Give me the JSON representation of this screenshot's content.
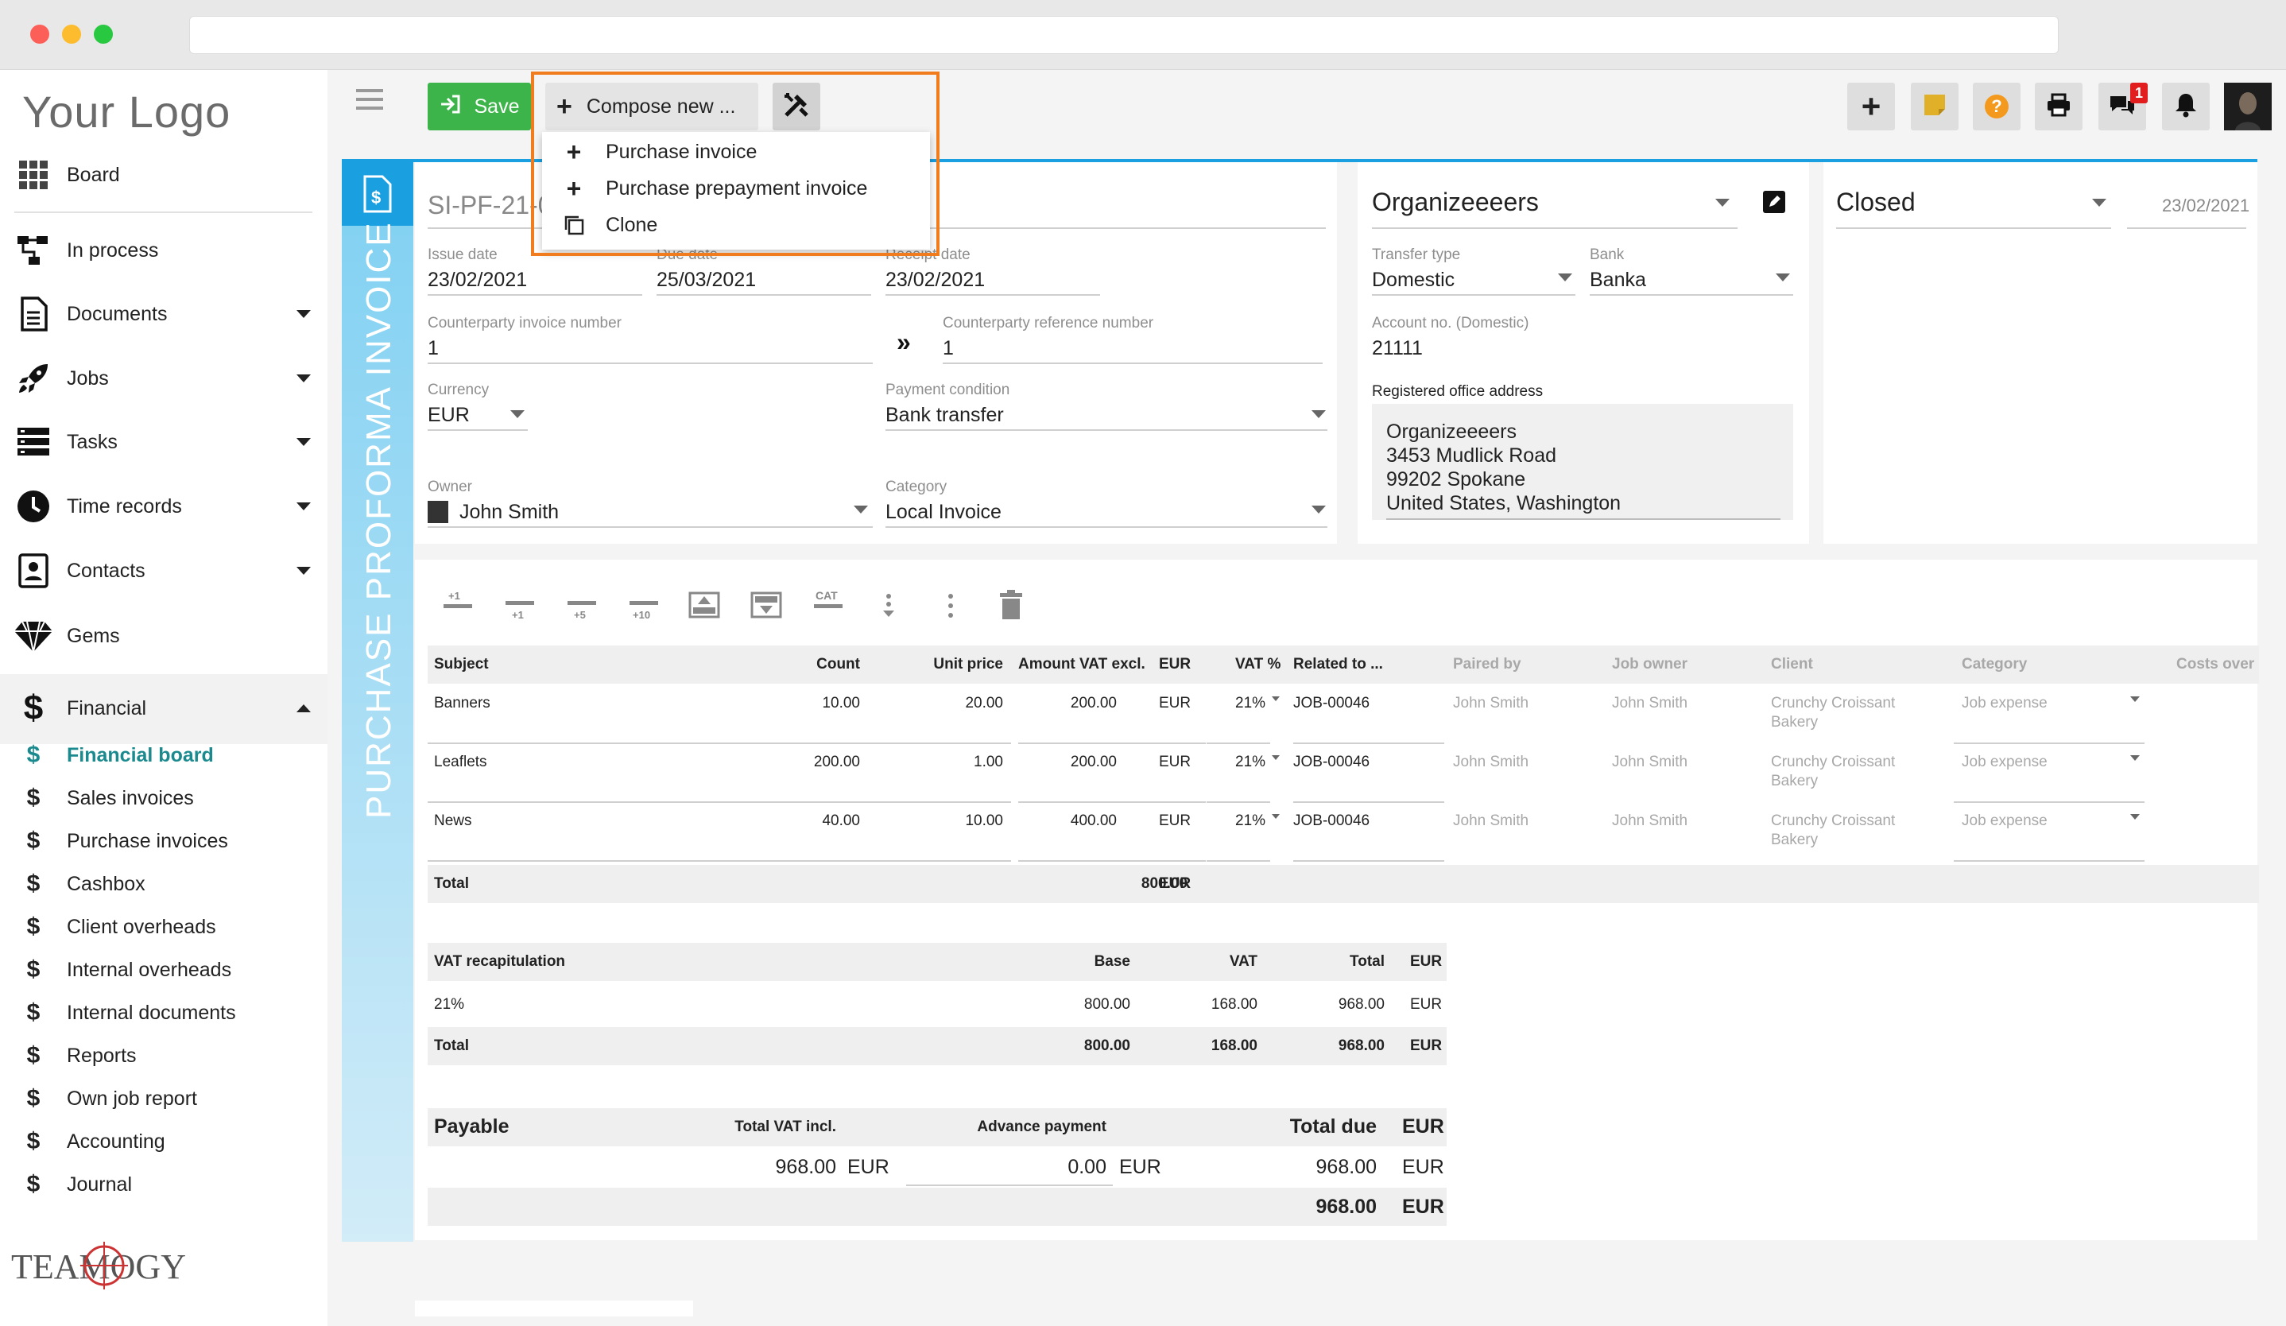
{
  "app": {
    "logo_text": "Your Logo",
    "footer_brand": "TEAMOGY"
  },
  "colors": {
    "accent_blue": "#1a9fe0",
    "save_green": "#3cb44a",
    "highlight_orange": "#f07c1e",
    "sticky_yellow": "#e0b028",
    "help_orange": "#f39a1e",
    "badge_red": "#e11d1d"
  },
  "sidebar": {
    "board": "Board",
    "items": [
      {
        "label": "In process",
        "icon": "workflow-icon"
      },
      {
        "label": "Documents",
        "icon": "document-icon"
      },
      {
        "label": "Jobs",
        "icon": "rocket-icon"
      },
      {
        "label": "Tasks",
        "icon": "tasks-icon"
      },
      {
        "label": "Time records",
        "icon": "clock-icon"
      },
      {
        "label": "Contacts",
        "icon": "contact-card-icon"
      },
      {
        "label": "Gems",
        "icon": "diamond-icon"
      },
      {
        "label": "Financial",
        "icon": "dollar-icon"
      }
    ],
    "financial_sub": [
      "Financial board",
      "Sales invoices",
      "Purchase invoices",
      "Cashbox",
      "Client overheads",
      "Internal overheads",
      "Internal documents",
      "Reports",
      "Own job report",
      "Accounting",
      "Journal"
    ]
  },
  "toolbar": {
    "save_label": "Save",
    "compose_label": "Compose new ...",
    "notification_count": "1"
  },
  "compose_menu": [
    "Purchase invoice",
    "Purchase prepayment invoice",
    "Clone"
  ],
  "document": {
    "vertical_title": "PURCHASE PROFORMA INVOICE",
    "number": "SI-PF-21-0",
    "issue_date_label": "Issue date",
    "issue_date": "23/02/2021",
    "due_date_label": "Due date",
    "due_date": "25/03/2021",
    "receipt_date_label": "Receipt date",
    "receipt_date": "23/02/2021",
    "cp_invoice_label": "Counterparty invoice number",
    "cp_invoice": "1",
    "cp_ref_label": "Counterparty reference number",
    "cp_ref": "1",
    "currency_label": "Currency",
    "currency": "EUR",
    "payment_label": "Payment condition",
    "payment": "Bank transfer",
    "owner_label": "Owner",
    "owner": "John Smith",
    "category_label": "Category",
    "category": "Local Invoice"
  },
  "counterparty": {
    "name": "Organizeeeers",
    "transfer_label": "Transfer type",
    "transfer": "Domestic",
    "bank_label": "Bank",
    "bank": "Banka",
    "account_label": "Account no. (Domestic)",
    "account": "21111",
    "address_label": "Registered office address",
    "address": [
      "Organizeeeers",
      "3453 Mudlick Road",
      "99202 Spokane",
      "United States, Washington"
    ]
  },
  "status": {
    "value": "Closed",
    "date": "23/02/2021"
  },
  "item_tools": [
    "+1",
    "+1",
    "+5",
    "+10",
    "CAT"
  ],
  "items_table": {
    "headers": {
      "subject": "Subject",
      "count": "Count",
      "unit_price": "Unit price",
      "amount": "Amount VAT excl.",
      "currency": "EUR",
      "vat": "VAT %",
      "related": "Related to ...",
      "paired": "Paired by",
      "job_owner": "Job owner",
      "client": "Client",
      "category": "Category",
      "costs": "Costs over"
    },
    "rows": [
      {
        "subject": "Banners",
        "count": "10.00",
        "unit_price": "20.00",
        "amount": "200.00",
        "currency": "EUR",
        "vat": "21%",
        "related": "JOB-00046",
        "paired": "John Smith",
        "job_owner": "John Smith",
        "client1": "Crunchy Croissant",
        "client2": "Bakery",
        "category": "Job expense"
      },
      {
        "subject": "Leaflets",
        "count": "200.00",
        "unit_price": "1.00",
        "amount": "200.00",
        "currency": "EUR",
        "vat": "21%",
        "related": "JOB-00046",
        "paired": "John Smith",
        "job_owner": "John Smith",
        "client1": "Crunchy Croissant",
        "client2": "Bakery",
        "category": "Job expense"
      },
      {
        "subject": "News",
        "count": "40.00",
        "unit_price": "10.00",
        "amount": "400.00",
        "currency": "EUR",
        "vat": "21%",
        "related": "JOB-00046",
        "paired": "John Smith",
        "job_owner": "John Smith",
        "client1": "Crunchy Croissant",
        "client2": "Bakery",
        "category": "Job expense"
      }
    ],
    "total_label": "Total",
    "total": "800.00",
    "total_currency": "EUR"
  },
  "vat_recap": {
    "headers": {
      "title": "VAT recapitulation",
      "base": "Base",
      "vat": "VAT",
      "total": "Total",
      "currency": "EUR"
    },
    "row": {
      "rate": "21%",
      "base": "800.00",
      "vat": "168.00",
      "total": "968.00",
      "currency": "EUR"
    },
    "total": {
      "label": "Total",
      "base": "800.00",
      "vat": "168.00",
      "total": "968.00",
      "currency": "EUR"
    }
  },
  "payable": {
    "title": "Payable",
    "vat_incl_label": "Total VAT incl.",
    "advance_label": "Advance payment",
    "due_label": "Total due",
    "currency_label": "EUR",
    "vat_incl": "968.00",
    "vat_incl_currency": "EUR",
    "advance": "0.00",
    "advance_currency": "EUR",
    "due": "968.00",
    "due_currency": "EUR",
    "final": "968.00",
    "final_currency": "EUR"
  }
}
